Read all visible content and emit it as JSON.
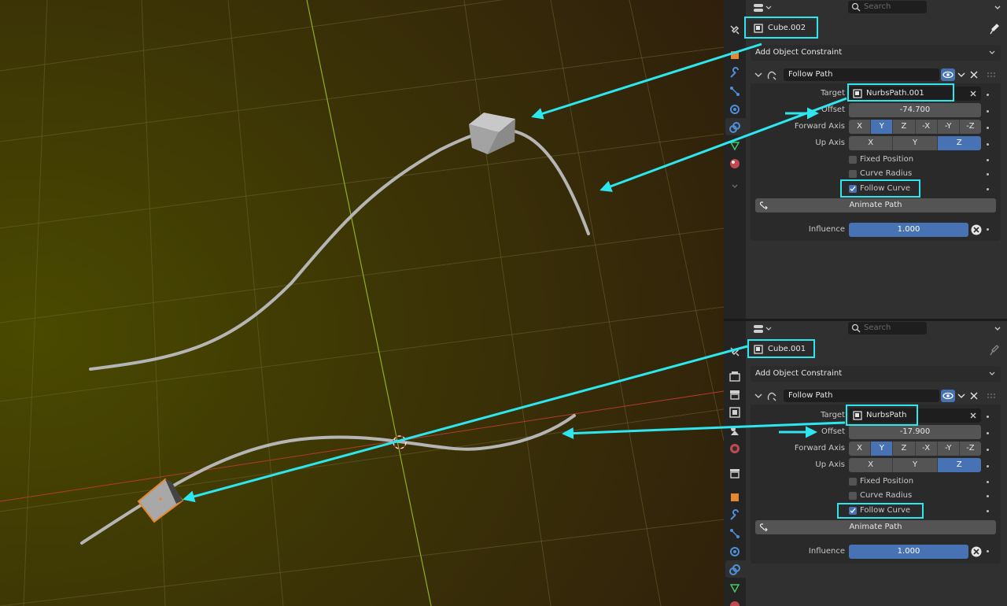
{
  "app": {
    "colors": {
      "accent": "#4772b3",
      "highlight": "#2ee6ee",
      "cube_selected_outline": "#e5882b"
    }
  },
  "panels": [
    {
      "search_placeholder": "Search",
      "object_name": "Cube.002",
      "add_constraint_label": "Add Object Constraint",
      "constraint": {
        "name": "Follow Path",
        "target_label": "Target",
        "target_value": "NurbsPath.001",
        "offset_label": "Offset",
        "offset_value": "-74.700",
        "forward_axis_label": "Forward Axis",
        "forward_axis_options": [
          "X",
          "Y",
          "Z",
          "-X",
          "-Y",
          "-Z"
        ],
        "forward_axis_selected": "Y",
        "up_axis_label": "Up Axis",
        "up_axis_options": [
          "X",
          "Y",
          "Z"
        ],
        "up_axis_selected": "Z",
        "fixed_position_label": "Fixed Position",
        "fixed_position": false,
        "curve_radius_label": "Curve Radius",
        "curve_radius": false,
        "follow_curve_label": "Follow Curve",
        "follow_curve": true,
        "animate_path_label": "Animate Path",
        "influence_label": "Influence",
        "influence_value": "1.000"
      }
    },
    {
      "search_placeholder": "Search",
      "object_name": "Cube.001",
      "add_constraint_label": "Add Object Constraint",
      "constraint": {
        "name": "Follow Path",
        "target_label": "Target",
        "target_value": "NurbsPath",
        "offset_label": "Offset",
        "offset_value": "-17.900",
        "forward_axis_label": "Forward Axis",
        "forward_axis_options": [
          "X",
          "Y",
          "Z",
          "-X",
          "-Y",
          "-Z"
        ],
        "forward_axis_selected": "Y",
        "up_axis_label": "Up Axis",
        "up_axis_options": [
          "X",
          "Y",
          "Z"
        ],
        "up_axis_selected": "Z",
        "fixed_position_label": "Fixed Position",
        "fixed_position": false,
        "curve_radius_label": "Curve Radius",
        "curve_radius": false,
        "follow_curve_label": "Follow Curve",
        "follow_curve": true,
        "animate_path_label": "Animate Path",
        "influence_label": "Influence",
        "influence_value": "1.000"
      }
    }
  ],
  "tab_icons_top": [
    "tool-icon",
    "object-icon",
    "modifier-wrench-icon",
    "particles-icon",
    "physics-icon",
    "constraint-icon",
    "object-data-icon",
    "material-icon",
    "expand-more-icon"
  ],
  "tab_icons_bottom": [
    "tool-icon",
    "render-icon",
    "output-icon",
    "view-layer-icon",
    "scene-icon",
    "world-icon",
    "collection-icon",
    "object-icon",
    "modifier-wrench-icon",
    "particles-icon",
    "physics-icon",
    "constraint-icon",
    "object-data-icon",
    "material-icon"
  ]
}
